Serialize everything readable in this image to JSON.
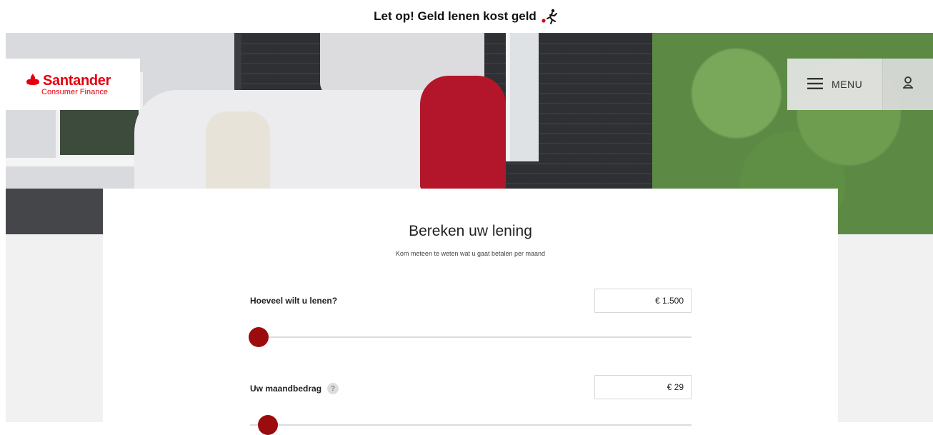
{
  "warning": {
    "text": "Let op! Geld lenen kost geld",
    "icon": "running-figure-icon"
  },
  "brand": {
    "name": "Santander",
    "subtitle": "Consumer Finance",
    "color": "#e3000f"
  },
  "nav": {
    "menu_label": "MENU",
    "menu_icon": "hamburger-icon",
    "user_icon": "user-icon"
  },
  "calculator": {
    "title": "Bereken uw lening",
    "subtitle": "Kom meteen te weten wat u gaat betalen per maand",
    "loan_amount": {
      "label": "Hoeveel wilt u lenen?",
      "value": "€ 1.500",
      "slider_position": 0.02
    },
    "monthly_amount": {
      "label": "Uw maandbedrag",
      "help": "?",
      "value": "€ 29",
      "slider_position": 0.04
    },
    "accent_color": "#9b0c0c"
  }
}
